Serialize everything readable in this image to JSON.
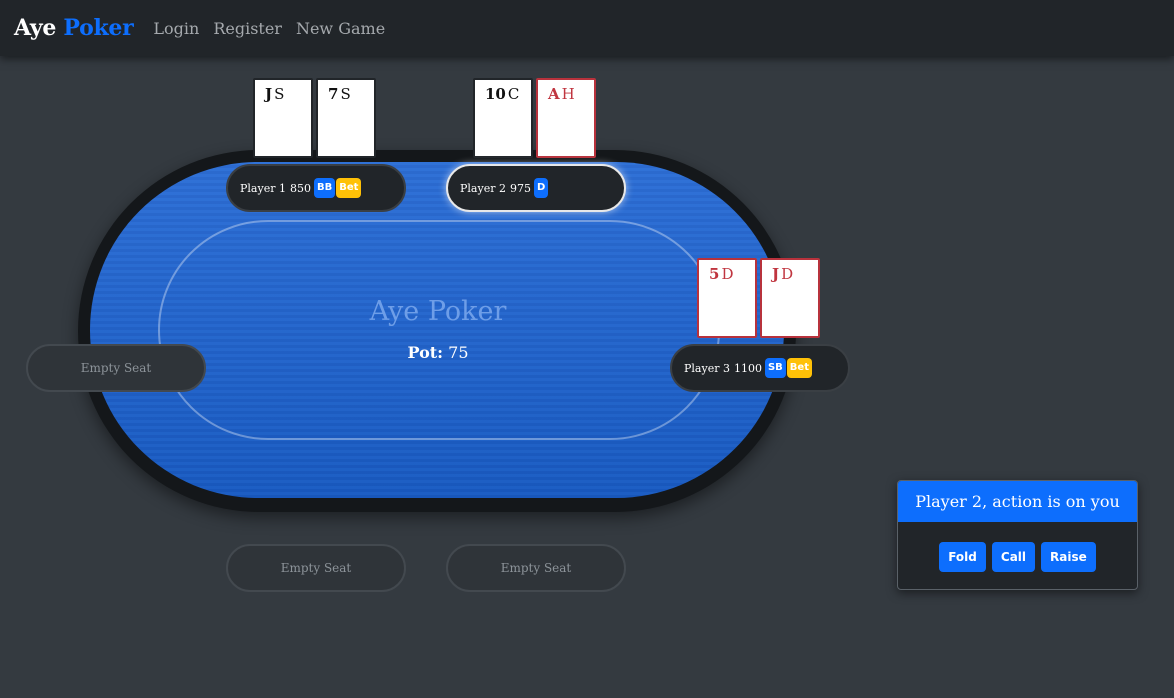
{
  "nav": {
    "brand_part1": "Aye",
    "brand_part2": "Poker",
    "links": [
      "Login",
      "Register",
      "New Game"
    ]
  },
  "table": {
    "title": "Aye Poker",
    "pot_label": "Pot:",
    "pot_value": "75"
  },
  "seats": [
    {
      "name": "Player 1",
      "chips": "850",
      "badges": [
        "BB",
        "Bet"
      ],
      "cards": [
        {
          "rank": "J",
          "suit": "S"
        },
        {
          "rank": "7",
          "suit": "S"
        }
      ]
    },
    {
      "name": "Player 2",
      "chips": "975",
      "badges": [
        "D"
      ],
      "active": true,
      "cards": [
        {
          "rank": "10",
          "suit": "C"
        },
        {
          "rank": "A",
          "suit": "H"
        }
      ]
    },
    {
      "name": "Player 3",
      "chips": "1100",
      "badges": [
        "SB",
        "Bet"
      ],
      "cards": [
        {
          "rank": "5",
          "suit": "D"
        },
        {
          "rank": "J",
          "suit": "D"
        }
      ]
    },
    {
      "empty_label": "Empty Seat"
    },
    {
      "empty_label": "Empty Seat"
    },
    {
      "empty_label": "Empty Seat"
    }
  ],
  "action": {
    "header": "Player 2, action is on you",
    "buttons": [
      "Fold",
      "Call",
      "Raise"
    ]
  },
  "colors": {
    "accent": "#0d6efd",
    "warning": "#ffc107",
    "felt": "#1f66d4",
    "background": "#343a40",
    "navbar": "#212529",
    "red_card": "#c0353f"
  }
}
